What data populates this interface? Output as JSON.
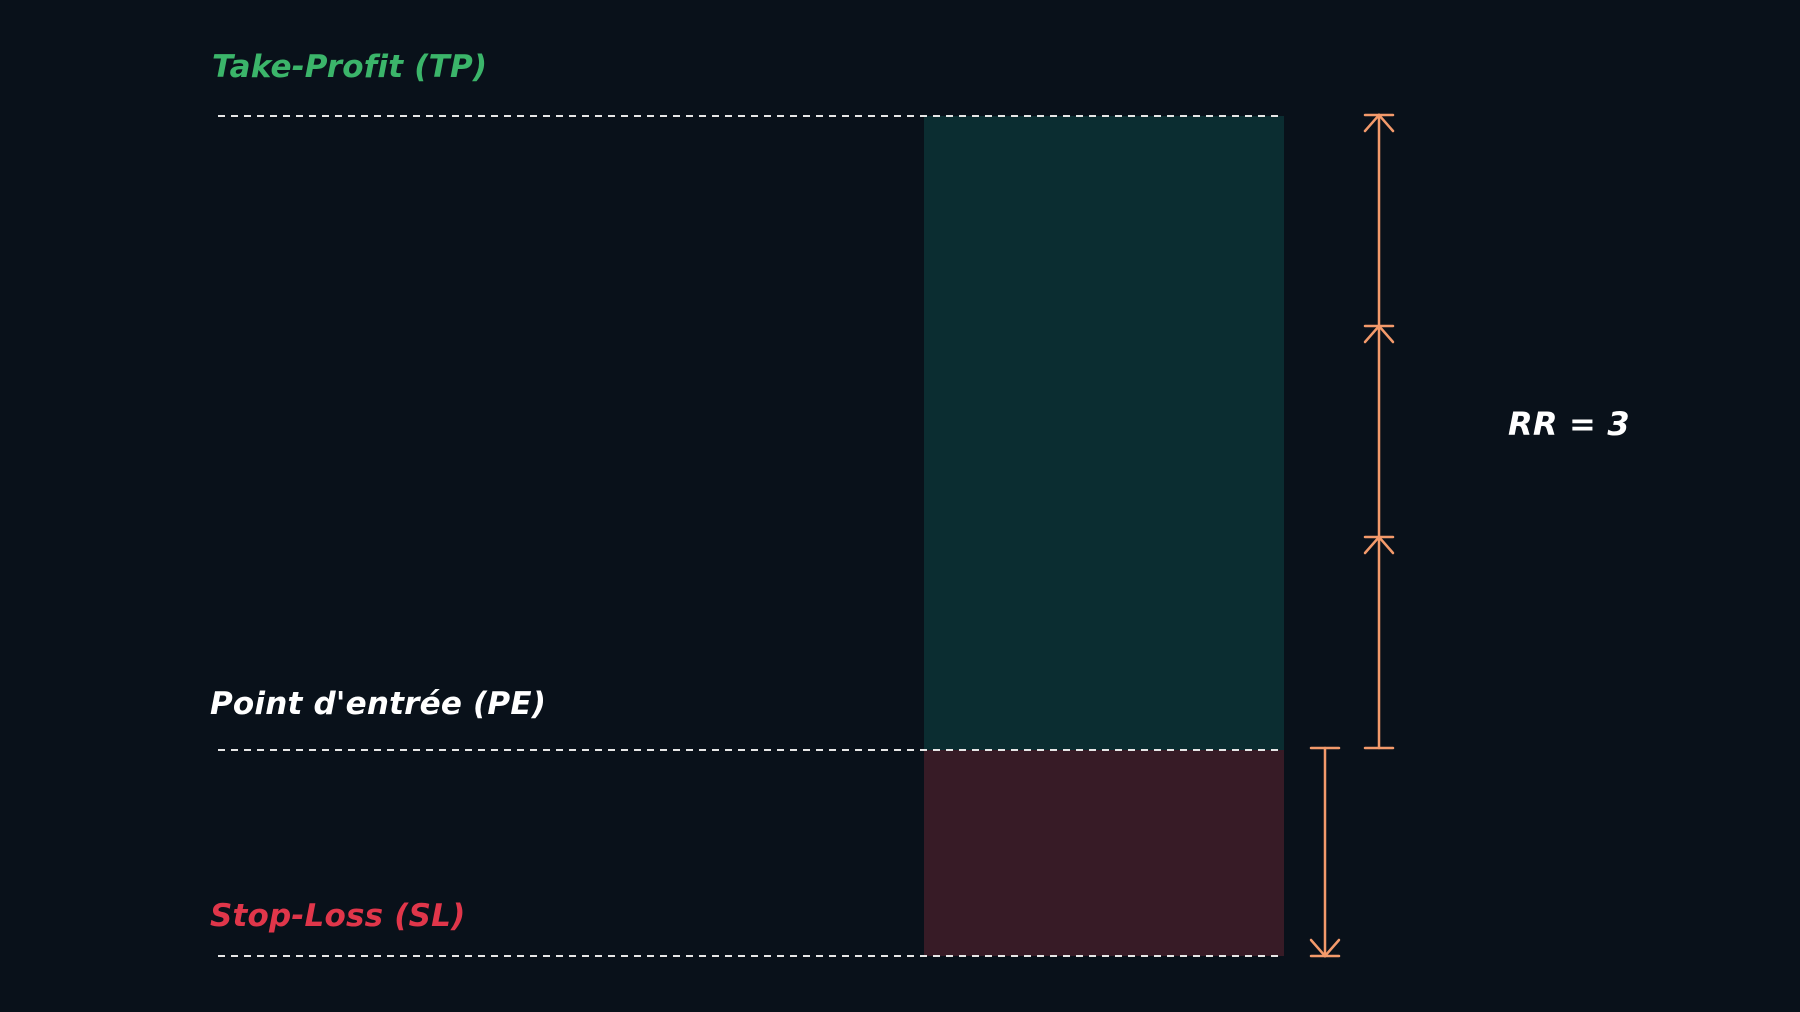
{
  "labels": {
    "take_profit": "Take-Profit (TP)",
    "entry_point": "Point d'entrée (PE)",
    "stop_loss": "Stop-Loss (SL)",
    "risk_reward": "RR = 3"
  },
  "colors": {
    "background": "#09111a",
    "take_profit": "#3bb56a",
    "entry_point": "#ffffff",
    "stop_loss": "#e0364a",
    "reward_zone": "#0b2d31",
    "risk_zone": "#371b26",
    "level_line": "#e6e6e6",
    "arrow": "#f39a6b"
  },
  "rr_value": 3
}
